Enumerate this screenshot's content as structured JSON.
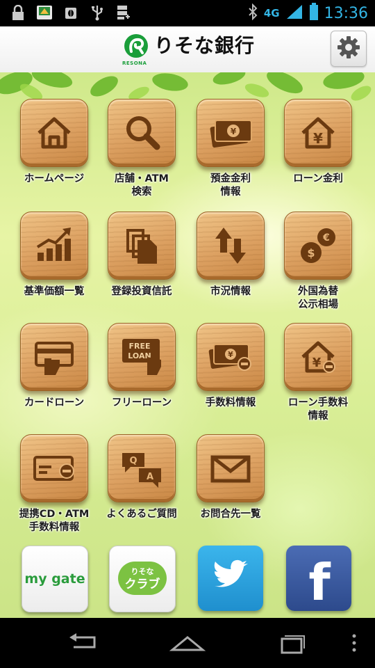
{
  "status_bar": {
    "time": "13:36",
    "network": "4G",
    "icons": [
      "lock-icon",
      "app-icon",
      "bug-icon",
      "usb-icon",
      "sd-card-icon",
      "bluetooth-icon",
      "signal-icon",
      "battery-icon"
    ]
  },
  "header": {
    "logo_text": "りそな銀行",
    "logo_sub": "RESONA",
    "settings_icon": "gear-icon"
  },
  "menu": [
    {
      "label": "ホームページ",
      "icon": "house-icon"
    },
    {
      "label": "店舗・ATM\n検索",
      "icon": "magnifier-icon"
    },
    {
      "label": "預金金利\n情報",
      "icon": "yen-banknote-icon"
    },
    {
      "label": "ローン金利",
      "icon": "yen-house-icon"
    },
    {
      "label": "基準価額一覧",
      "icon": "bar-chart-icon"
    },
    {
      "label": "登録投資信託",
      "icon": "documents-icon"
    },
    {
      "label": "市況情報",
      "icon": "up-down-arrows-icon"
    },
    {
      "label": "外国為替\n公示相場",
      "icon": "currency-coins-icon"
    },
    {
      "label": "カードローン",
      "icon": "card-hand-icon"
    },
    {
      "label": "フリーローン",
      "icon": "free-loan-icon"
    },
    {
      "label": "手数料情報",
      "icon": "banknote-minus-icon"
    },
    {
      "label": "ローン手数料\n情報",
      "icon": "house-minus-icon"
    },
    {
      "label": "提携CD・ATM\n手数料情報",
      "icon": "card-minus-icon"
    },
    {
      "label": "よくあるご質問",
      "icon": "faq-bubbles-icon"
    },
    {
      "label": "お問合先一覧",
      "icon": "envelope-icon"
    }
  ],
  "bottom_links": {
    "mygate": "my gate",
    "resona_club_top": "りそな",
    "resona_club": "クラブ",
    "twitter": "twitter-bird-icon",
    "facebook": "f"
  },
  "freeloan_text": [
    "FREE",
    "LOAN"
  ],
  "faq_letters": [
    "Q",
    "A"
  ],
  "colors": {
    "accent": "#33b5e5",
    "brand_green": "#1a9e3a",
    "wood": "#dca061",
    "twitter": "#2aa3dc",
    "facebook": "#3b5998"
  }
}
